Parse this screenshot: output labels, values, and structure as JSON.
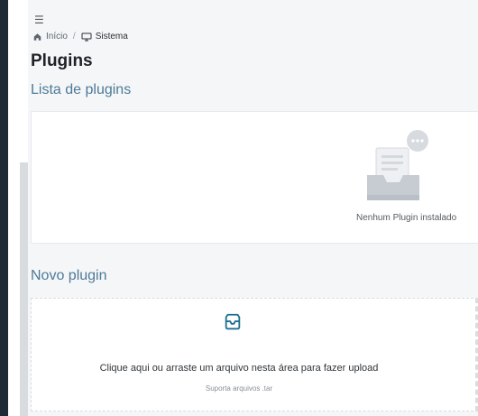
{
  "nav": {
    "menu_icon": "menu-icon"
  },
  "breadcrumb": {
    "home_icon": "home-icon",
    "home_label": "Início",
    "separator": "/",
    "system_icon": "monitor-icon",
    "current_label": "Sistema"
  },
  "page": {
    "title": "Plugins"
  },
  "plugins_list": {
    "section_title": "Lista de plugins",
    "empty_state_icon": "empty-inbox-icon",
    "empty_message": "Nenhum Plugin instalado"
  },
  "new_plugin": {
    "section_title": "Novo plugin",
    "upload_icon": "inbox-icon",
    "upload_message": "Clique aqui ou arraste um arquivo nesta área para fazer upload",
    "upload_hint": "Suporta arquivos .tar"
  },
  "colors": {
    "sidebar": "#1f2a37",
    "accent": "#4d7a99",
    "upload_icon": "#1f6f93"
  }
}
